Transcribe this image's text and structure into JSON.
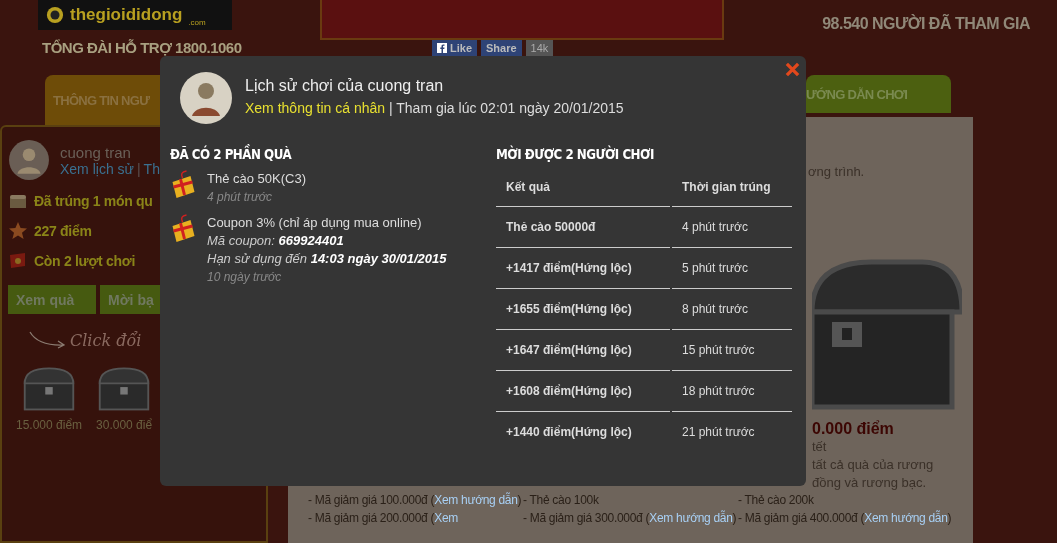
{
  "header": {
    "logo": "thegioididong",
    "logo_sub": ".com",
    "hotline": "TỔNG ĐÀI HỖ TRỢ 1800.1060",
    "participants": "98.540 NGƯỜI ĐÃ THAM GIA",
    "social": [
      {
        "kind": "like",
        "label": "Like"
      },
      {
        "kind": "share",
        "label": "Share"
      },
      {
        "kind": "count",
        "label": "14k"
      }
    ]
  },
  "tabs": [
    {
      "label": "THÔNG TIN NGƯ",
      "selected": true
    },
    {
      "label": "ƯỚNG DẪN CHƠI",
      "selected": false
    }
  ],
  "profile": {
    "name": "cuong tran",
    "links": [
      "Xem lịch sử",
      "Th"
    ],
    "separator": "|",
    "stats": [
      {
        "kind": "chest",
        "text": "Đã trúng 1 món qu"
      },
      {
        "kind": "star",
        "text": "227 điểm"
      },
      {
        "kind": "flag",
        "text": "Còn 2 lượt chơi"
      }
    ],
    "buttons": [
      "Xem quà",
      "Mời bạ"
    ],
    "click_hint": "Click đổi",
    "chests": [
      {
        "label": "15.000 điểm"
      },
      {
        "label": "30.000 điể"
      }
    ]
  },
  "guide": {
    "intro": "ơng trình.",
    "prize_title": "0.000 điểm",
    "prize_lines": [
      "tết",
      "tất cả quà của rương",
      "đồng và rương bạc."
    ],
    "columns": [
      [
        {
          "text": "- Mã giảm giá 100.000đ (",
          "link": "Xem hướng dẫn",
          "after": ")"
        },
        {
          "text": "- Mã giảm giá 200.000đ (",
          "link": "Xem"
        }
      ],
      [
        {
          "text": "- Thẻ cào 100k"
        },
        {
          "text": "- Mã giảm giá 300.000đ (",
          "link": "Xem hướng dẫn",
          "after": ")"
        }
      ],
      [
        {
          "text": "- Thẻ cào 200k"
        },
        {
          "text": "- Mã giảm giá 400.000đ (",
          "link": "Xem hướng dẫn",
          "after": ")"
        }
      ]
    ]
  },
  "modal": {
    "title": "Lịch sử chơi của cuong tran",
    "profile_link": "Xem thông tin cá nhân",
    "joined": "| Tham gia lúc 02:01 ngày 20/01/2015",
    "gifts_heading": "ĐÃ CÓ 2 PHẦN QUÀ",
    "gifts": [
      {
        "name": "Thẻ cào 50K(C3)",
        "time": "4 phút trước"
      },
      {
        "name": "Coupon 3% (chỉ áp dụng mua online)",
        "details": [
          {
            "label": "Mã coupon:",
            "value": "669924401"
          },
          {
            "label": "Hạn sử dụng đến",
            "value": "14:03 ngày 30/01/2015"
          }
        ],
        "time": "10 ngày trước"
      }
    ],
    "invite_heading": "MỜI ĐƯỢC 2 NGƯỜI CHƠI",
    "table": {
      "columns": [
        "Kết quả",
        "Thời gian trúng"
      ],
      "rows": [
        [
          "Thẻ cào 50000đ",
          "4 phút trước"
        ],
        [
          "+1417 điểm(Hứng lộc)",
          "5 phút trước"
        ],
        [
          "+1655 điểm(Hứng lộc)",
          "8 phút trước"
        ],
        [
          "+1647 điểm(Hứng lộc)",
          "15 phút trước"
        ],
        [
          "+1608 điểm(Hứng lộc)",
          "18 phút trước"
        ],
        [
          "+1440 điểm(Hứng lộc)",
          "21 phút trước"
        ]
      ]
    }
  }
}
